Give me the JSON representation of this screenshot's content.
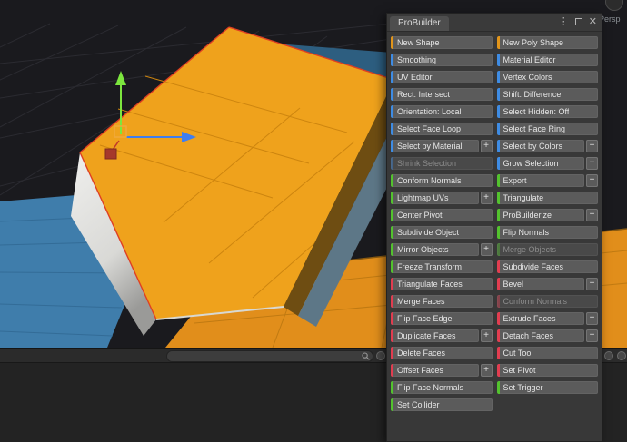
{
  "scene": {
    "persp_label": "Persp"
  },
  "toolbar": {
    "search_placeholder": ""
  },
  "colors": {
    "orange": "#e2951a",
    "blue": "#3e8ce4",
    "green": "#53c32e",
    "red": "#e23d50"
  },
  "panel": {
    "title": "ProBuilder",
    "kebab_glyph": "⋮",
    "close_glyph": "✕",
    "plus_glyph": "+",
    "columns": [
      {
        "buttons": [
          {
            "label": "New Shape",
            "cat": "orange"
          },
          {
            "label": "Smoothing",
            "cat": "blue"
          },
          {
            "label": "UV Editor",
            "cat": "blue"
          },
          {
            "label": "Rect: Intersect",
            "cat": "blue"
          },
          {
            "label": "Orientation: Local",
            "cat": "blue"
          },
          {
            "label": "Select Face Loop",
            "cat": "blue"
          },
          {
            "label": "Select by Material",
            "cat": "blue",
            "plus": true
          },
          {
            "label": "Shrink Selection",
            "cat": "blue",
            "disabled": true
          },
          {
            "label": "Conform Normals",
            "cat": "green"
          },
          {
            "label": "Lightmap UVs",
            "cat": "green",
            "plus": true
          },
          {
            "label": "Center Pivot",
            "cat": "green"
          },
          {
            "label": "Subdivide Object",
            "cat": "green"
          },
          {
            "label": "Mirror Objects",
            "cat": "green",
            "plus": true
          },
          {
            "label": "Freeze Transform",
            "cat": "green"
          },
          {
            "label": "Triangulate Faces",
            "cat": "red"
          },
          {
            "label": "Merge Faces",
            "cat": "red"
          },
          {
            "label": "Flip Face Edge",
            "cat": "red"
          },
          {
            "label": "Duplicate Faces",
            "cat": "red",
            "plus": true
          },
          {
            "label": "Delete Faces",
            "cat": "red"
          },
          {
            "label": "Offset Faces",
            "cat": "red",
            "plus": true
          },
          {
            "label": "Flip Face Normals",
            "cat": "green"
          },
          {
            "label": "Set Collider",
            "cat": "green"
          }
        ]
      },
      {
        "buttons": [
          {
            "label": "New Poly Shape",
            "cat": "orange"
          },
          {
            "label": "Material Editor",
            "cat": "blue"
          },
          {
            "label": "Vertex Colors",
            "cat": "blue"
          },
          {
            "label": "Shift: Difference",
            "cat": "blue"
          },
          {
            "label": "Select Hidden: Off",
            "cat": "blue"
          },
          {
            "label": "Select Face Ring",
            "cat": "blue"
          },
          {
            "label": "Select by Colors",
            "cat": "blue",
            "plus": true
          },
          {
            "label": "Grow Selection",
            "cat": "blue",
            "plus": true
          },
          {
            "label": "Export",
            "cat": "green",
            "plus": true
          },
          {
            "label": "Triangulate",
            "cat": "green"
          },
          {
            "label": "ProBuilderize",
            "cat": "green",
            "plus": true
          },
          {
            "label": "Flip Normals",
            "cat": "green"
          },
          {
            "label": "Merge Objects",
            "cat": "green",
            "disabled": true
          },
          {
            "label": "Subdivide Faces",
            "cat": "red"
          },
          {
            "label": "Bevel",
            "cat": "red",
            "plus": true
          },
          {
            "label": "Conform Normals",
            "cat": "red",
            "disabled": true
          },
          {
            "label": "Extrude Faces",
            "cat": "red",
            "plus": true
          },
          {
            "label": "Detach Faces",
            "cat": "red",
            "plus": true
          },
          {
            "label": "Cut Tool",
            "cat": "red"
          },
          {
            "label": "Set Pivot",
            "cat": "red"
          },
          {
            "label": "Set Trigger",
            "cat": "green"
          }
        ]
      }
    ]
  }
}
